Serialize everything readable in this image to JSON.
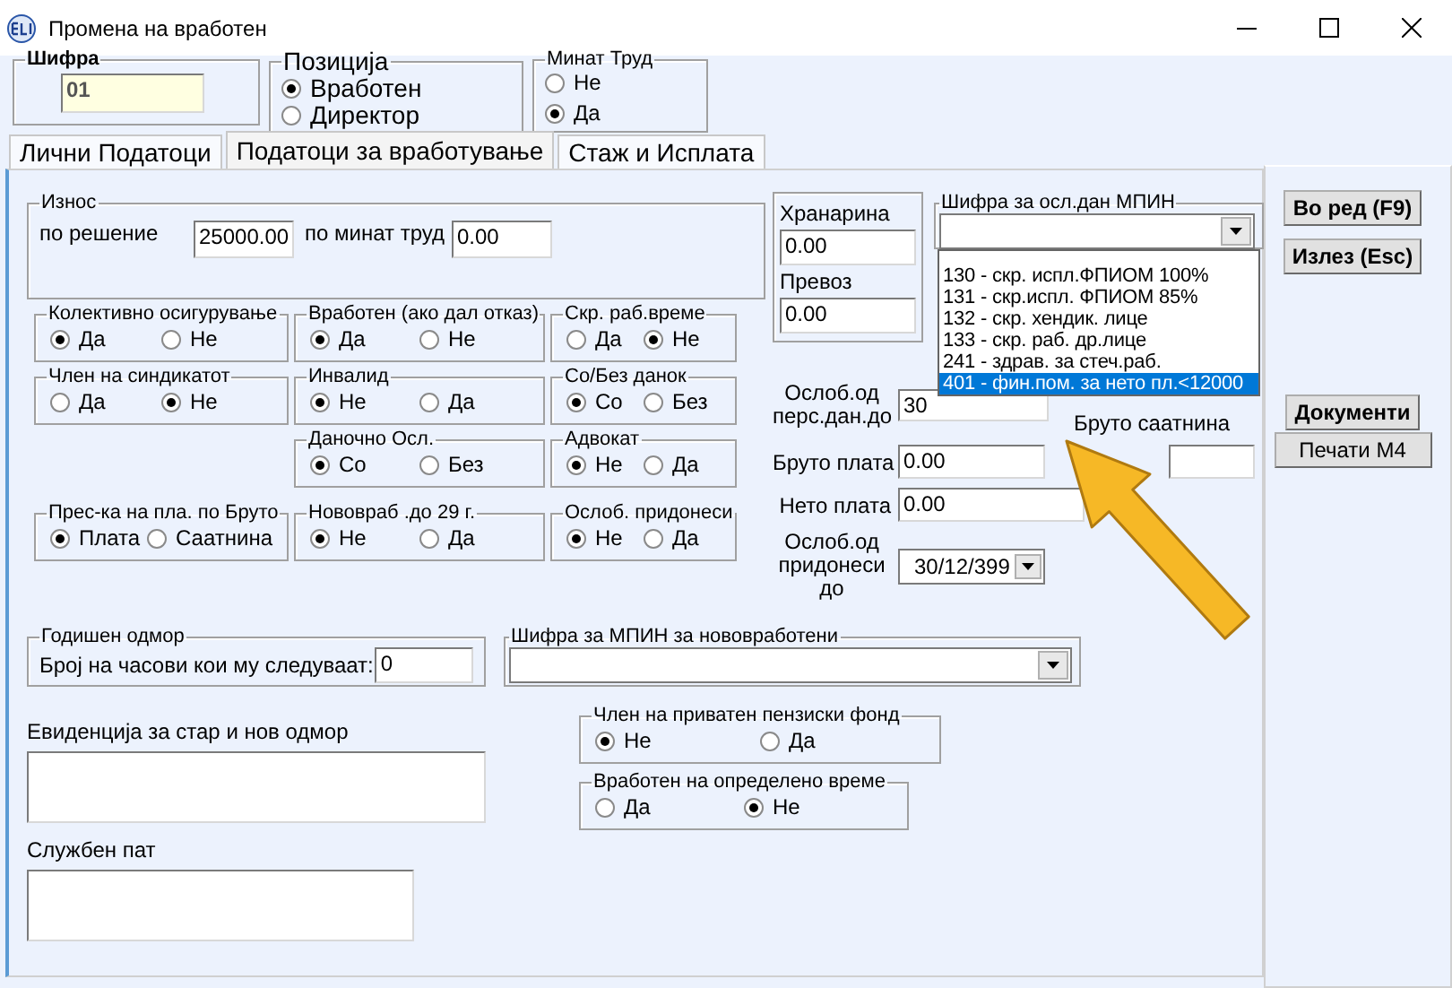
{
  "window": {
    "title": "Промена на вработен"
  },
  "code": {
    "label": "Шифра",
    "value": "01"
  },
  "position": {
    "label": "Позиција",
    "options": [
      {
        "label": "Вработен",
        "selected": true
      },
      {
        "label": "Директор",
        "selected": false
      }
    ]
  },
  "past_work": {
    "label": "Минат Труд",
    "options": [
      {
        "label": "Не",
        "selected": false
      },
      {
        "label": "Да",
        "selected": true
      }
    ]
  },
  "tabs": [
    {
      "label": "Лични Податоци",
      "selected": false
    },
    {
      "label": "Податоци за вработување",
      "selected": true
    },
    {
      "label": "Стаж и Исплата",
      "selected": false
    }
  ],
  "amount": {
    "label": "Износ",
    "by_decision_label": "по решение",
    "by_decision": "25000.00",
    "past_work_label": "по минат труд",
    "past_work": "0.00"
  },
  "radio_rows": [
    [
      {
        "label": "Колективно осигурување",
        "options": [
          {
            "label": "Да",
            "selected": true
          },
          {
            "label": "Не",
            "selected": false
          }
        ]
      },
      {
        "label": "Вработен (ако дал отказ)",
        "options": [
          {
            "label": "Да",
            "selected": true
          },
          {
            "label": "Не",
            "selected": false
          }
        ]
      },
      {
        "label": "Скр. раб.време",
        "options": [
          {
            "label": "Да",
            "selected": false
          },
          {
            "label": "Не",
            "selected": true
          }
        ]
      }
    ],
    [
      {
        "label": "Член на синдикатот",
        "options": [
          {
            "label": "Да",
            "selected": false
          },
          {
            "label": "Не",
            "selected": true
          }
        ]
      },
      {
        "label": "Инвалид",
        "options": [
          {
            "label": "Не",
            "selected": true
          },
          {
            "label": "Да",
            "selected": false
          }
        ]
      },
      {
        "label": "Со/Без данок",
        "options": [
          {
            "label": "Со",
            "selected": true
          },
          {
            "label": "Без",
            "selected": false
          }
        ]
      }
    ],
    [
      {
        "label": "Даночно Осл.",
        "options": [
          {
            "label": "Со",
            "selected": true
          },
          {
            "label": "Без",
            "selected": false
          }
        ]
      },
      {
        "label": "Адвокат",
        "options": [
          {
            "label": "Не",
            "selected": true
          },
          {
            "label": "Да",
            "selected": false
          }
        ]
      }
    ],
    [
      {
        "label": "Прес-ка на пла. по  Бруто",
        "options": [
          {
            "label": "Плата",
            "selected": true
          },
          {
            "label": "Саатнина",
            "selected": false
          }
        ]
      },
      {
        "label": "Нововраб .до 29 г.",
        "options": [
          {
            "label": "Не",
            "selected": true
          },
          {
            "label": "Да",
            "selected": false
          }
        ]
      },
      {
        "label": "Ослоб. придонеси",
        "options": [
          {
            "label": "Не",
            "selected": true
          },
          {
            "label": "Да",
            "selected": false
          }
        ]
      }
    ]
  ],
  "allowances": {
    "food_label": "Хранарина",
    "food": "0.00",
    "transport_label": "Превоз",
    "transport": "0.00"
  },
  "mpin": {
    "label": "Шифра за осл.дан МПИН",
    "expanded": true,
    "items": [
      {
        "label": "130 - скр. испл.ФПИОМ 100%",
        "selected": false
      },
      {
        "label": "131 - скр.испл. ФПИОМ 85%",
        "selected": false
      },
      {
        "label": "132 - скр. хендик. лице",
        "selected": false
      },
      {
        "label": "133 - скр. раб. др.лице",
        "selected": false
      },
      {
        "label": "241 - здрав. за стеч.раб.",
        "selected": false
      },
      {
        "label": "401 - фин.пом. за нето пл.<12000",
        "selected": true
      }
    ]
  },
  "tax_relief": {
    "label": "Ослоб.од перс.дан.до",
    "value": "30"
  },
  "gross_hourly": {
    "label": "Бруто саатнина"
  },
  "gross": {
    "label": "Бруто плата",
    "value": "0.00"
  },
  "net": {
    "label": "Нето плата",
    "value": "0.00"
  },
  "contrib_relief": {
    "label": "Ослоб.од придонеси до",
    "value": "30/12/399"
  },
  "annual_leave": {
    "label": "Годишен одмор",
    "hours_label": "Број на часови кои му следуваат:",
    "hours": "0"
  },
  "new_mpin": {
    "label": "Шифра за МПИН за нововработени"
  },
  "leave_record": {
    "label": "Евиденција за стар и нов одмор"
  },
  "business_trip": {
    "label": "Службен пат"
  },
  "pension_fund": {
    "label": "Член на приватен пензиски фонд",
    "options": [
      {
        "label": "Не",
        "selected": true
      },
      {
        "label": "Да",
        "selected": false
      }
    ]
  },
  "fixed_term": {
    "label": "Вработен на определено време",
    "options": [
      {
        "label": "Да",
        "selected": false
      },
      {
        "label": "Не",
        "selected": true
      }
    ]
  },
  "buttons": [
    {
      "label": "Во ред (F9)",
      "kind": "bold"
    },
    {
      "label": "Излез (Esc)",
      "kind": "bold"
    },
    {
      "label": "Документи",
      "kind": "bold"
    },
    {
      "label": "Печати М4",
      "kind": "plain"
    }
  ]
}
